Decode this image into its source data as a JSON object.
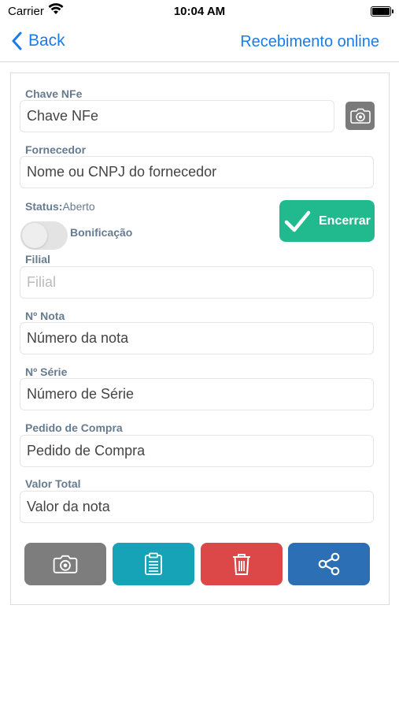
{
  "status_bar": {
    "carrier": "Carrier",
    "time": "10:04 AM"
  },
  "nav": {
    "back_label": "Back",
    "title": "Recebimento online"
  },
  "form": {
    "chave": {
      "label": "Chave NFe",
      "placeholder": "Chave NFe"
    },
    "fornecedor": {
      "label": "Fornecedor",
      "placeholder": "Nome ou CNPJ do fornecedor"
    },
    "status": {
      "label": "Status:",
      "value": "Aberto"
    },
    "bonificacao": {
      "label": "Bonificação",
      "on": false
    },
    "encerrar_label": "Encerrar",
    "filial": {
      "label": "Filial",
      "placeholder": "Filial"
    },
    "nota": {
      "label": "Nº Nota",
      "placeholder": "Número da nota"
    },
    "serie": {
      "label": "Nº Série",
      "placeholder": "Número de Série"
    },
    "pedido": {
      "label": "Pedido de Compra",
      "placeholder": "Pedido de Compra"
    },
    "valor": {
      "label": "Valor Total",
      "placeholder": "Valor da nota"
    }
  },
  "actions": [
    {
      "icon": "camera-icon",
      "color": "#7d7d7d"
    },
    {
      "icon": "clipboard-icon",
      "color": "#16a2b7"
    },
    {
      "icon": "trash-icon",
      "color": "#dc4747"
    },
    {
      "icon": "share-icon",
      "color": "#2c6fb4"
    }
  ],
  "colors": {
    "accent": "#1a7ce6",
    "label": "#667b8f",
    "encerrar": "#21ba8e"
  }
}
